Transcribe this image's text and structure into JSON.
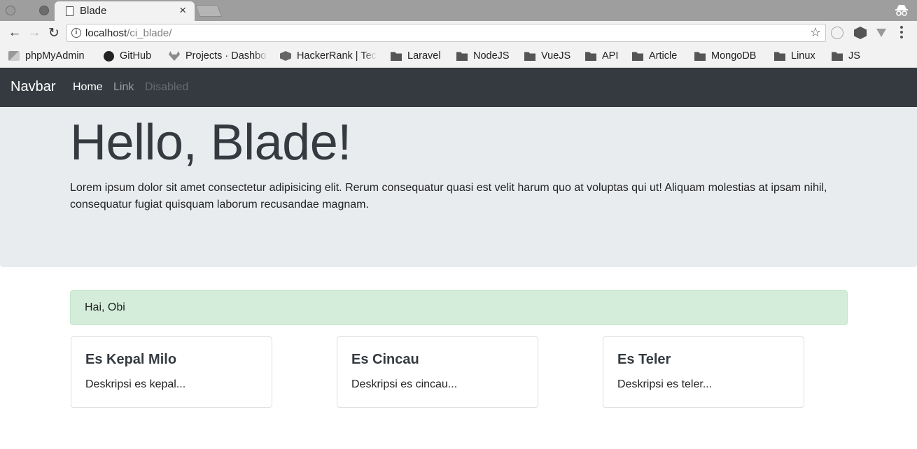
{
  "browser": {
    "tab_title": "Blade",
    "tab_close": "×",
    "url_host": "localhost",
    "url_path": "/ci_blade/",
    "star": "☆",
    "info": "i",
    "nav_back": "←",
    "nav_forward": "→",
    "nav_reload": "↻"
  },
  "bookmarks": [
    {
      "label": "phpMyAdmin",
      "icon": "phpmyadmin-icon"
    },
    {
      "label": "GitHub",
      "icon": "github-icon"
    },
    {
      "label": "Projects · Dashbo",
      "icon": "gitlab-icon"
    },
    {
      "label": "HackerRank | Tec",
      "icon": "hackerrank-icon"
    },
    {
      "label": "Laravel",
      "icon": "folder-icon"
    },
    {
      "label": "NodeJS",
      "icon": "folder-icon"
    },
    {
      "label": "VueJS",
      "icon": "folder-icon"
    },
    {
      "label": "API",
      "icon": "folder-icon"
    },
    {
      "label": "Article",
      "icon": "folder-icon"
    },
    {
      "label": "MongoDB",
      "icon": "folder-icon"
    },
    {
      "label": "Linux",
      "icon": "folder-icon"
    },
    {
      "label": "JS",
      "icon": "folder-icon"
    }
  ],
  "navbar": {
    "brand": "Navbar",
    "home": "Home",
    "link": "Link",
    "disabled": "Disabled"
  },
  "jumbotron": {
    "heading": "Hello, Blade!",
    "lead": "Lorem ipsum dolor sit amet consectetur adipisicing elit. Rerum consequatur quasi est velit harum quo at voluptas qui ut! Aliquam molestias at ipsam nihil, consequatur fugiat quisquam laborum recusandae magnam."
  },
  "alert": {
    "text": "Hai, Obi"
  },
  "cards": [
    {
      "title": "Es Kepal Milo",
      "text": "Deskripsi es kepal..."
    },
    {
      "title": "Es Cincau",
      "text": "Deskripsi es cincau..."
    },
    {
      "title": "Es Teler",
      "text": "Deskripsi es teler..."
    }
  ],
  "colors": {
    "navbar_bg": "#343a40",
    "jumbotron_bg": "#e9ecef",
    "alert_bg": "#d4edda"
  }
}
